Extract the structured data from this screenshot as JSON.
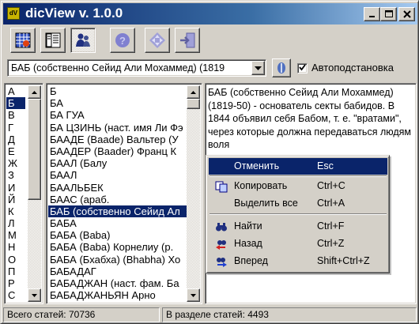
{
  "window": {
    "title": "dicView v. 1.0.0",
    "icon_text": "dV",
    "controls": {
      "minimize": "_",
      "maximize": "□",
      "close": "✕"
    }
  },
  "toolbar": {
    "buttons": [
      {
        "name": "calendar-icon"
      },
      {
        "name": "panels-icon"
      },
      {
        "name": "user-icon"
      },
      {
        "name": "help-icon"
      },
      {
        "name": "navigation-icon"
      },
      {
        "name": "exit-icon"
      }
    ]
  },
  "search": {
    "value": "БАБ (собственно Сейид Али Мохаммед) (1819",
    "autocomplete_label": "Автоподстановка",
    "autocomplete_checked": true
  },
  "letters": [
    "А",
    "Б",
    "В",
    "Г",
    "Д",
    "Е",
    "Ж",
    "З",
    "И",
    "Й",
    "К",
    "Л",
    "М",
    "Н",
    "О",
    "П",
    "Р",
    "С"
  ],
  "selected_letter": "Б",
  "words": [
    "Б",
    "БА",
    "БА ГУА",
    "БА ЦЗИНЬ (наст. имя Ли Фэ",
    "БААДЕ (Baade) Вальтер (У",
    "БААДЕР (Baader) Франц К",
    "БААЛ (Балу",
    "БААЛ",
    "БААЛЬБЕК",
    "БААС (араб.",
    "БАБ (собственно Сейид Ал",
    "БАБА",
    "БАБА (Baba)",
    "БАБА (Baba) Корнелиу (р.",
    "БАБА (Бхабха) (Bhabha) Хо",
    "БАБАДАГ",
    "БАБАДЖАН (наст. фам. Ба",
    "БАБАДЖАНЬЯН Арно"
  ],
  "selected_word": "БАБ (собственно Сейид Ал",
  "article": {
    "text": "БАБ (собственно Сейид Али Мохаммед) (1819-50) - основатель секты бабидов. В 1844 объявил себя Бабом, т. е. \"вратами\", через которые должна передаваться людям воля"
  },
  "context_menu": {
    "items": [
      {
        "label": "Отменить",
        "shortcut": "Esc",
        "icon": ""
      },
      {
        "label": "Копировать",
        "shortcut": "Ctrl+C",
        "icon": "copy-icon"
      },
      {
        "label": "Выделить все",
        "shortcut": "Ctrl+A",
        "icon": ""
      },
      {
        "label": "Найти",
        "shortcut": "Ctrl+F",
        "icon": "binoculars-icon"
      },
      {
        "label": "Назад",
        "shortcut": "Ctrl+Z",
        "icon": "back-binoculars-icon"
      },
      {
        "label": "Вперед",
        "shortcut": "Shift+Ctrl+Z",
        "icon": "forward-binoculars-icon"
      }
    ],
    "highlighted": "Отменить"
  },
  "status": {
    "total_label": "Всего статей: 70736",
    "section_label": "В разделе статей: 4493"
  },
  "colors": {
    "selection": "#0a246a",
    "face": "#d4d0c8",
    "title_gradient_start": "#0a246a",
    "title_gradient_end": "#a6caf0"
  }
}
